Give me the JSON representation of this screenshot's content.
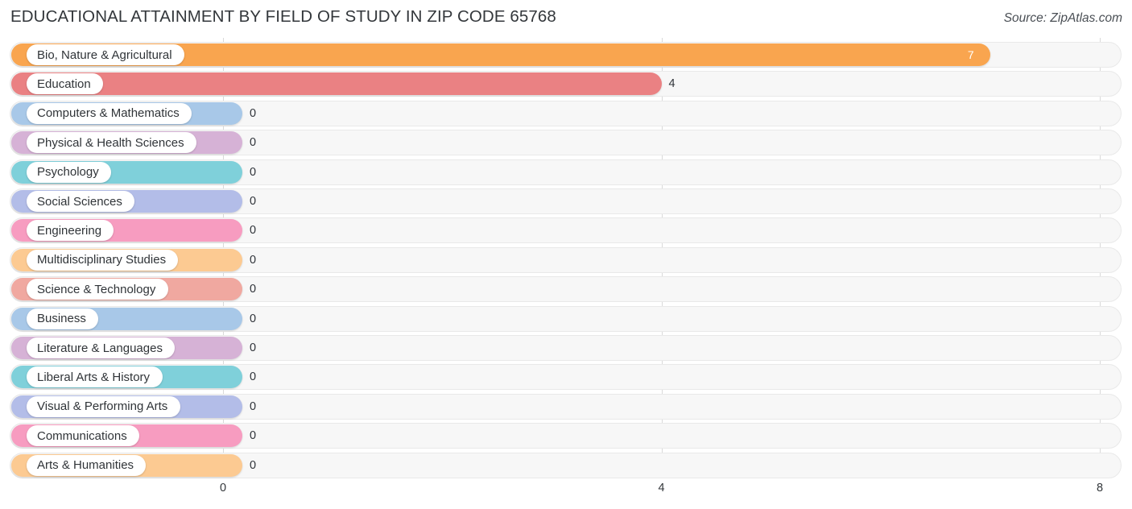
{
  "header": {
    "title": "EDUCATIONAL ATTAINMENT BY FIELD OF STUDY IN ZIP CODE 65768",
    "source": "Source: ZipAtlas.com"
  },
  "chart_data": {
    "type": "bar",
    "orientation": "horizontal",
    "title": "EDUCATIONAL ATTAINMENT BY FIELD OF STUDY IN ZIP CODE 65768",
    "xlabel": "",
    "ylabel": "",
    "xlim": [
      0,
      8
    ],
    "xticks": [
      0,
      4,
      8
    ],
    "xtick_labels": [
      "0",
      "4",
      "8"
    ],
    "grid": true,
    "legend": null,
    "categories": [
      "Bio, Nature & Agricultural",
      "Education",
      "Computers & Mathematics",
      "Physical & Health Sciences",
      "Psychology",
      "Social Sciences",
      "Engineering",
      "Multidisciplinary Studies",
      "Science & Technology",
      "Business",
      "Literature & Languages",
      "Liberal Arts & History",
      "Visual & Performing Arts",
      "Communications",
      "Arts & Humanities"
    ],
    "values": [
      7,
      4,
      0,
      0,
      0,
      0,
      0,
      0,
      0,
      0,
      0,
      0,
      0,
      0,
      0
    ],
    "value_labels": [
      "7",
      "4",
      "0",
      "0",
      "0",
      "0",
      "0",
      "0",
      "0",
      "0",
      "0",
      "0",
      "0",
      "0",
      "0"
    ],
    "bar_colors": [
      "#f9a54f",
      "#ea8183",
      "#a8c8e8",
      "#d6b2d6",
      "#7fd0da",
      "#b3bde8",
      "#f79cc0",
      "#fcca92",
      "#f0a8a0",
      "#a8c8e8",
      "#d6b2d6",
      "#7fd0da",
      "#b3bde8",
      "#f79cc0",
      "#fcca92"
    ]
  }
}
